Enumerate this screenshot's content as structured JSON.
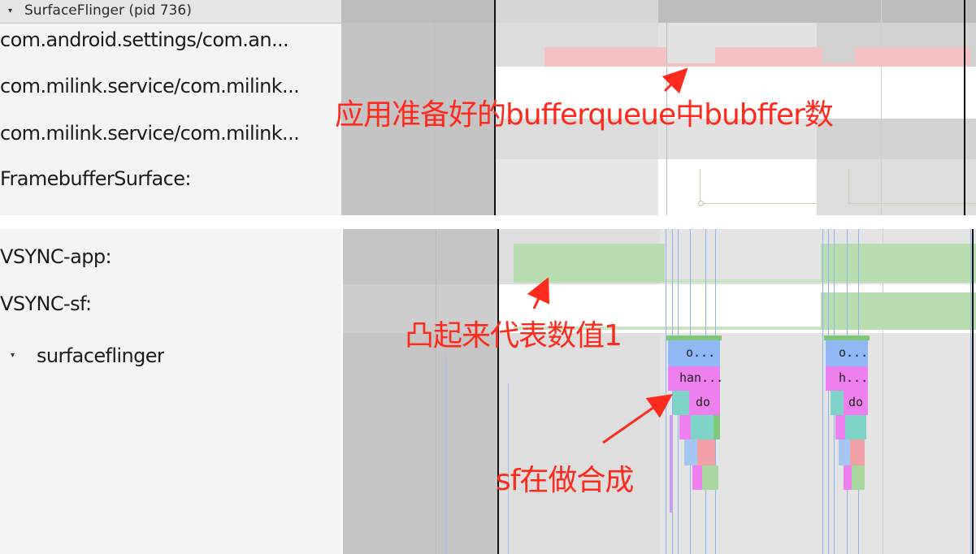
{
  "top_panel": {
    "process_title": "SurfaceFlinger (pid 736)",
    "tracks": [
      {
        "label": "com.android.settings/com.an..."
      },
      {
        "label": "com.milink.service/com.milink..."
      },
      {
        "label": "com.milink.service/com.milink..."
      },
      {
        "label": "FramebufferSurface:"
      }
    ]
  },
  "bottom_panel": {
    "tracks": [
      {
        "label": "VSYNC-app:"
      },
      {
        "label": "VSYNC-sf:"
      },
      {
        "label": "surfaceflinger"
      }
    ],
    "slices": {
      "left_row1": "o...",
      "left_row2": "han...",
      "left_row3": "do",
      "right_row1": "o...",
      "right_row2": "h...",
      "right_row3": "do"
    }
  },
  "annotations": {
    "buffer_count": "应用准备好的bufferqueue中bubffer数",
    "raised_value": "凸起来代表数值1",
    "sf_composing": "sf在做合成"
  },
  "colors": {
    "annotation": "#ff2a1e",
    "buffer_bar": "#f4c2c2",
    "vsync_bar": "#b9dcb0",
    "slice_blue": "#8fb8f4",
    "slice_pink": "#ee7fee",
    "slice_teal": "#7fd4c8"
  }
}
